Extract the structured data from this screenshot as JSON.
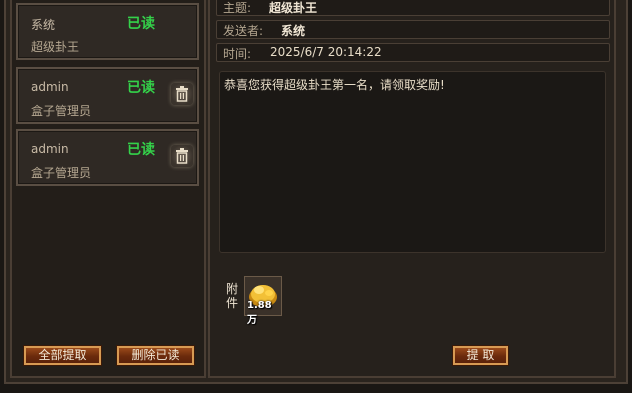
{
  "mail_list": [
    {
      "sender": "系统",
      "status": "已读",
      "subject": "超级卦王",
      "deletable": false
    },
    {
      "sender": "admin",
      "status": "已读",
      "subject": "盒子管理员",
      "deletable": true
    },
    {
      "sender": "admin",
      "status": "已读",
      "subject": "盒子管理员",
      "deletable": true
    }
  ],
  "buttons": {
    "claim_all": "全部提取",
    "delete_read": "删除已读",
    "claim": "提 取"
  },
  "detail": {
    "subject_label": "主题:",
    "subject_value": "超级卦王",
    "sender_label": "发送者:",
    "sender_value": "系统",
    "time_label": "时间:",
    "time_value": "2025/6/7 20:14:22",
    "body": "恭喜您获得超级卦王第一名，请领取奖励!"
  },
  "attachment": {
    "label": "附件",
    "item_icon": "gold-coins-icon",
    "count": "1.88万"
  },
  "colors": {
    "read_status": "#34d14a",
    "button_border": "#d79a53",
    "button_fill": "#7a3412"
  }
}
